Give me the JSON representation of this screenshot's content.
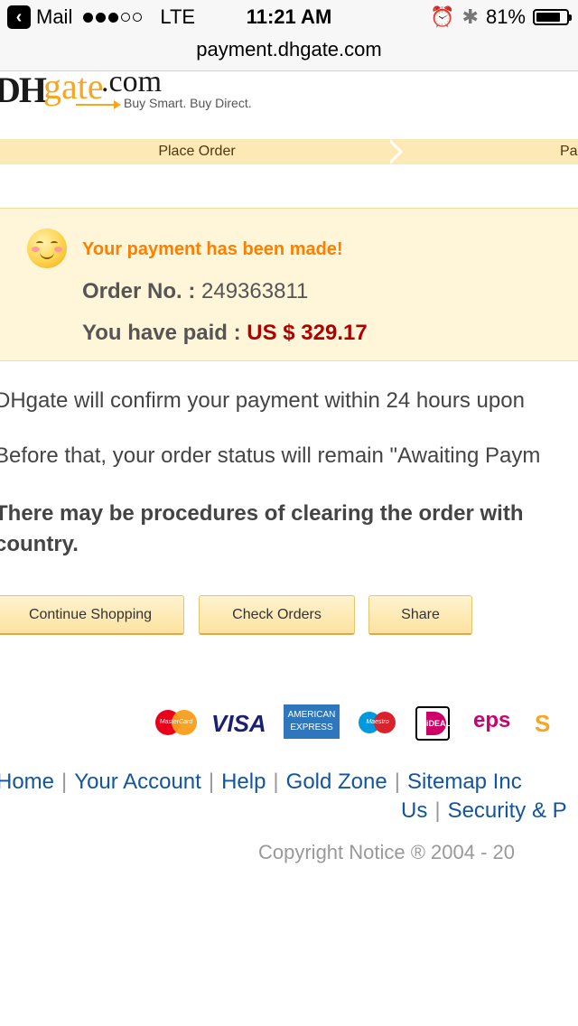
{
  "status_bar": {
    "back_app": "Mail",
    "carrier": "LTE",
    "time": "11:21 AM",
    "battery": "81%",
    "battery_level": 0.81
  },
  "url": "payment.dhgate.com",
  "logo": {
    "dh": "DH",
    "gate": "gate",
    "com": ".com",
    "slogan": "Buy Smart. Buy Direct."
  },
  "steps": {
    "step1": "Place Order",
    "step2": "Pa"
  },
  "result": {
    "title": "Your payment has been made!",
    "order_label": "Order No. :",
    "order_no": "249363811",
    "paid_label": "You have paid :",
    "paid_amount": "US $ 329.17"
  },
  "body": {
    "p1": "DHgate will confirm your payment within 24 hours upon",
    "p2": "Before that, your order status will remain \"Awaiting Paym",
    "p3": "There may be procedures of clearing the order with country."
  },
  "buttons": {
    "continue": "Continue Shopping",
    "check": "Check Orders",
    "share": "Share"
  },
  "payment_logos": {
    "mastercard": "MasterCard",
    "visa": "VISA",
    "amex": "AMERICAN EXPRESS",
    "maestro": "Maestro",
    "ideal": "iDEAL",
    "eps": "eps",
    "sofort": "S"
  },
  "footer": {
    "links_row1": [
      "Home",
      "Your Account",
      "Help",
      "Gold Zone",
      "Sitemap Inc"
    ],
    "links_row2": [
      "Us",
      "Security & P"
    ],
    "copyright": "Copyright Notice ® 2004 - 20"
  }
}
